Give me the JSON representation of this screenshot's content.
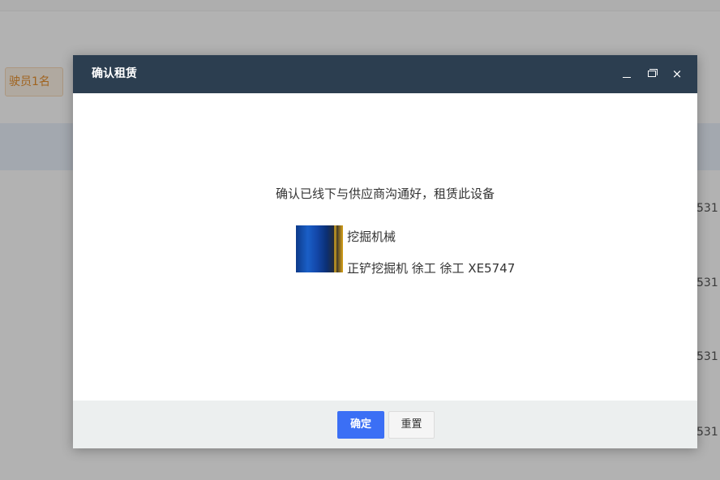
{
  "background": {
    "tag_label": "驶员1名",
    "row_values": [
      "531",
      "531",
      "531",
      "531"
    ]
  },
  "dialog": {
    "title": "确认租赁",
    "header_buttons": {
      "minimize": "_",
      "close": "×"
    },
    "message": "确认已线下与供应商沟通好，租赁此设备",
    "equipment": {
      "name": "挖掘机械",
      "description": "正铲挖掘机 徐工 徐工 XE5747",
      "thumbnail_icon": "equipment-photo"
    },
    "buttons": {
      "confirm": "确定",
      "reset": "重置"
    }
  },
  "colors": {
    "header_bg": "#2c3e50",
    "primary": "#3b6ff5",
    "footer_bg": "#ecefef",
    "tag_text": "#e6902e"
  }
}
